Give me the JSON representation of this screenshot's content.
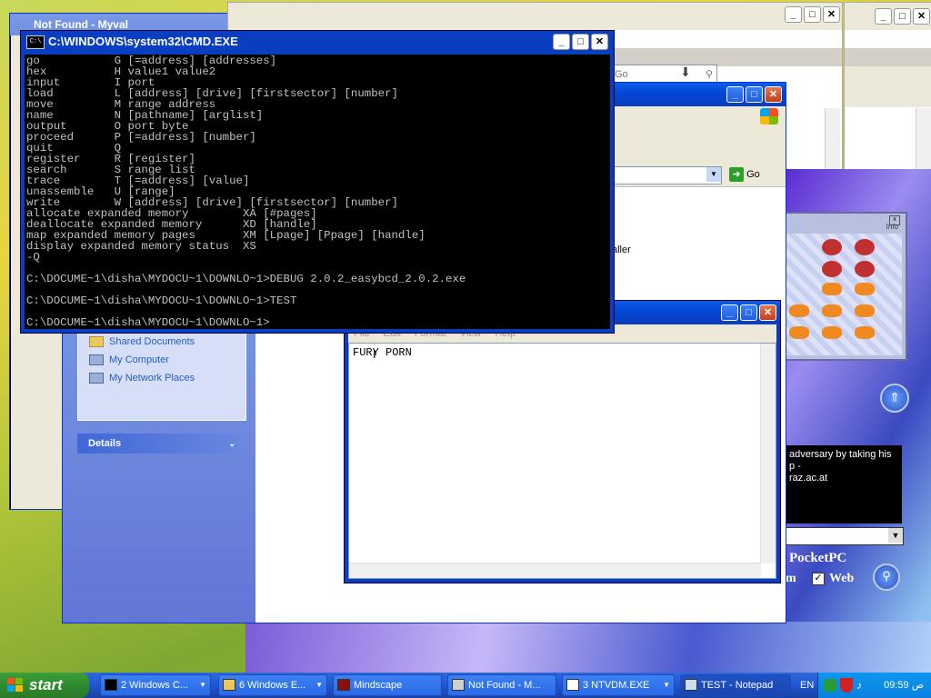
{
  "windows": {
    "myvnc": {
      "title": "Not Found - Myval"
    },
    "cmd": {
      "title": "C:\\WINDOWS\\system32\\CMD.EXE",
      "lines": [
        "go           G [=address] [addresses]",
        "hex          H value1 value2",
        "input        I port",
        "load         L [address] [drive] [firstsector] [number]",
        "move         M range address",
        "name         N [pathname] [arglist]",
        "output       O port byte",
        "proceed      P [=address] [number]",
        "quit         Q",
        "register     R [register]",
        "search       S range list",
        "trace        T [=address] [value]",
        "unassemble   U [range]",
        "write        W [address] [drive] [firstsector] [number]",
        "allocate expanded memory        XA [#pages]",
        "deallocate expanded memory      XD [handle]",
        "map expanded memory pages       XM [Lpage] [Ppage] [handle]",
        "display expanded memory status  XS",
        "-Q",
        "",
        "C:\\DOCUME~1\\disha\\MYDOCU~1\\DOWNLO~1>DEBUG 2.0.2_easybcd_2.0.2.exe",
        "",
        "C:\\DOCUME~1\\disha\\MYDOCU~1\\DOWNLO~1>TEST",
        "",
        "C:\\DOCUME~1\\disha\\MYDOCU~1\\DOWNLO~1>"
      ]
    },
    "explorer": {
      "go_label": "Go",
      "other_places": [
        "My Documents",
        "Shared Documents",
        "My Computer",
        "My Network Places"
      ],
      "details_label": "Details",
      "partial_text": "aller"
    },
    "notepad": {
      "menu": [
        "File",
        "Edit",
        "Format",
        "View",
        "Help"
      ],
      "content": "FURY PORN"
    },
    "browser_top": {
      "search_go": "Go"
    },
    "pocketpc": {
      "info": "Info",
      "snippet_line1": "adversary by taking his",
      "snippet_line2": "p -",
      "snippet_line3": "raz.ac.at",
      "title": "PocketPC",
      "m_label": "m",
      "web_label": "Web"
    }
  },
  "taskbar": {
    "start": "start",
    "items": [
      {
        "label": "2 Windows C..."
      },
      {
        "label": "6 Windows E..."
      },
      {
        "label": "Mindscape"
      },
      {
        "label": "Not Found - M..."
      },
      {
        "label": "3 NTVDM.EXE"
      },
      {
        "label": "TEST - Notepad"
      }
    ],
    "lang": "EN",
    "clock": "09:59 ص"
  }
}
